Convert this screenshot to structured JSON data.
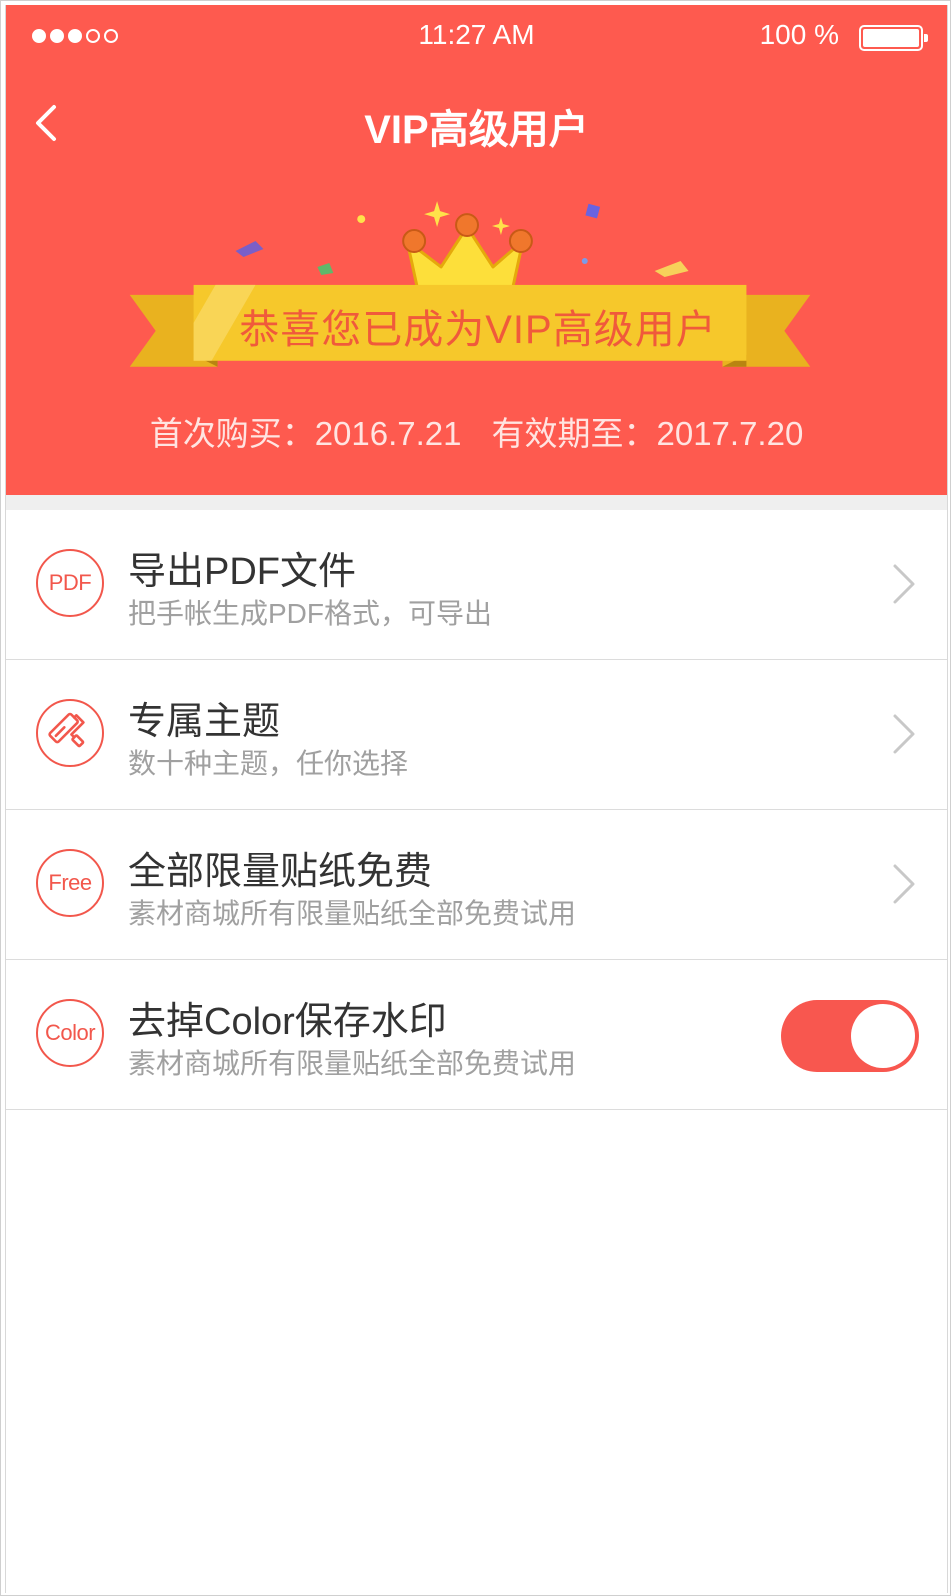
{
  "status_bar": {
    "time": "11:27 AM",
    "battery": "100 %"
  },
  "nav": {
    "title": "VIP高级用户"
  },
  "banner": {
    "text": "恭喜您已成为VIP高级用户",
    "first_purchase": "首次购买：2016.7.21",
    "valid_until": "有效期至：2017.7.20"
  },
  "features": [
    {
      "icon": "PDF",
      "title": "导出PDF文件",
      "subtitle": "把手帐生成PDF格式，可导出"
    },
    {
      "icon": "paint-roller",
      "title": "专属主题",
      "subtitle": "数十种主题，任你选择"
    },
    {
      "icon": "Free",
      "title": "全部限量贴纸免费",
      "subtitle": "素材商城所有限量贴纸全部免费试用"
    },
    {
      "icon": "Color",
      "title": "去掉Color保存水印",
      "subtitle": "素材商城所有限量贴纸全部免费试用",
      "toggle_on": true
    }
  ],
  "colors": {
    "accent": "#fe5a4f",
    "ribbon": "#f6c82b",
    "ribbon_text": "#f05a3b"
  }
}
